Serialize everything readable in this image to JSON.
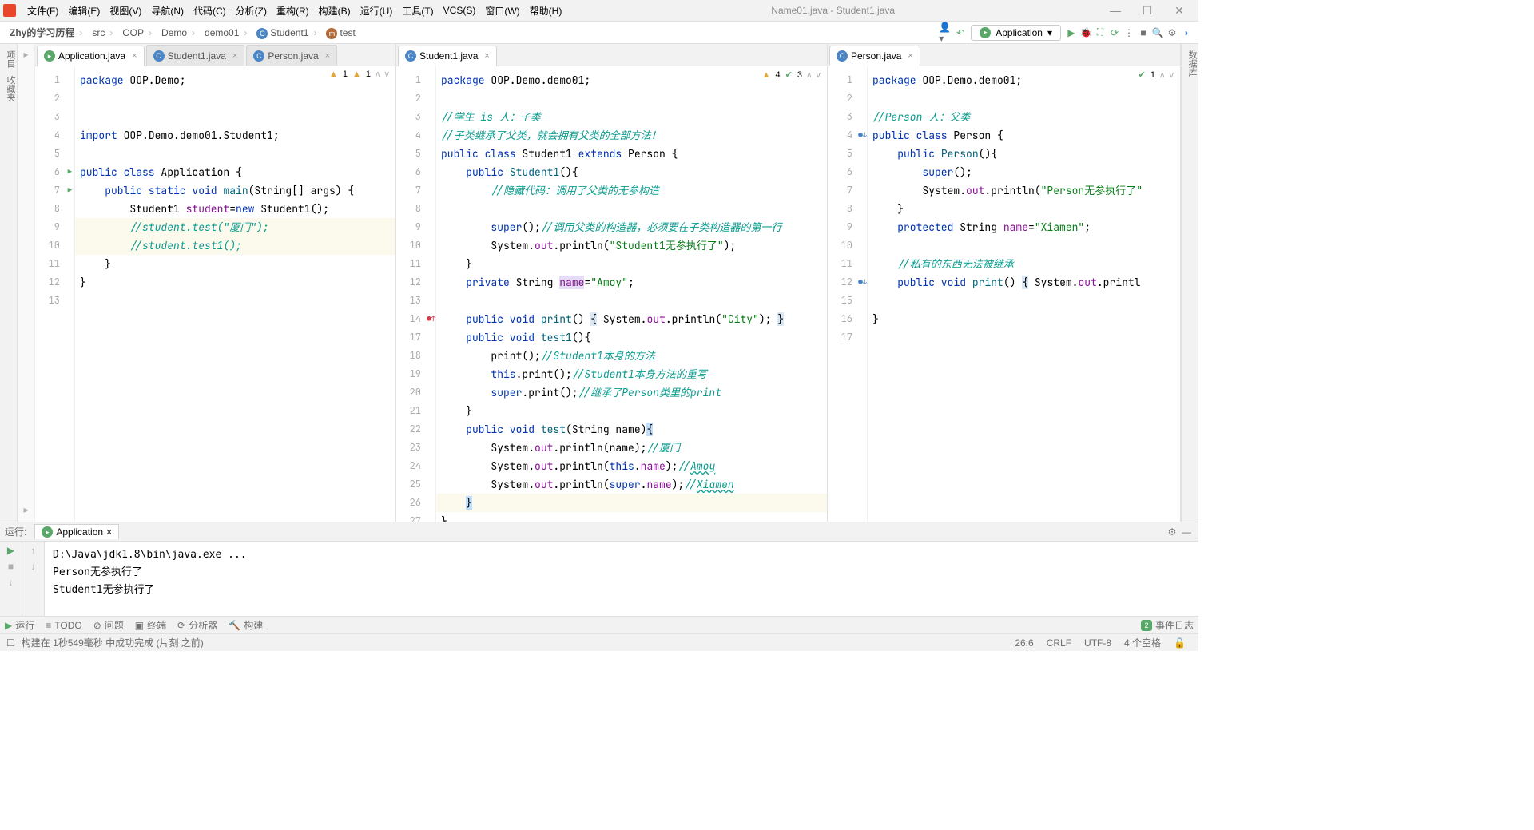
{
  "window": {
    "title": "Name01.java - Student1.java"
  },
  "menu": {
    "file": "文件(F)",
    "edit": "编辑(E)",
    "view": "视图(V)",
    "nav": "导航(N)",
    "code": "代码(C)",
    "analyze": "分析(Z)",
    "refactor": "重构(R)",
    "build": "构建(B)",
    "run": "运行(U)",
    "tools": "工具(T)",
    "vcs": "VCS(S)",
    "window": "窗口(W)",
    "help": "帮助(H)"
  },
  "breadcrumbs": [
    "Zhy的学习历程",
    "src",
    "OOP",
    "Demo",
    "demo01",
    "Student1",
    "test"
  ],
  "run_config": "Application",
  "panes": {
    "left": {
      "tabs": [
        {
          "label": "Application.java",
          "icon": "green",
          "active": true
        },
        {
          "label": "Student1.java",
          "icon": "blue",
          "active": false
        },
        {
          "label": "Person.java",
          "icon": "blue",
          "active": false
        }
      ],
      "insp": {
        "warn1": "1",
        "warn2": "1"
      },
      "lines": [
        {
          "n": "1",
          "html": "<span class='kw'>package</span> OOP.Demo;"
        },
        {
          "n": "2",
          "html": ""
        },
        {
          "n": "3",
          "html": ""
        },
        {
          "n": "4",
          "html": "<span class='kw'>import</span> OOP.Demo.demo01.Student1;"
        },
        {
          "n": "5",
          "html": ""
        },
        {
          "n": "6",
          "run": true,
          "html": "<span class='kw'>public class</span> Application {"
        },
        {
          "n": "7",
          "run": true,
          "html": "    <span class='kw'>public static void</span> <span class='mtd'>main</span>(String[] args) {"
        },
        {
          "n": "8",
          "html": "        Student1 <span class='fld'>student</span>=<span class='kw'>new</span> Student1();"
        },
        {
          "n": "9",
          "hl": true,
          "html": "        <span class='cmt-doc'>//student.test(\"厦门\");</span>"
        },
        {
          "n": "10",
          "hl": true,
          "html": "        <span class='cmt-doc'>//student.test1();</span>"
        },
        {
          "n": "11",
          "html": "    }"
        },
        {
          "n": "12",
          "html": "}"
        },
        {
          "n": "13",
          "html": ""
        }
      ]
    },
    "mid": {
      "tabs": [
        {
          "label": "Student1.java",
          "icon": "blue",
          "active": true
        }
      ],
      "insp": {
        "warn": "4",
        "ok": "3"
      },
      "lines": [
        {
          "n": "1",
          "html": "<span class='kw'>package</span> OOP.Demo.demo01;"
        },
        {
          "n": "2",
          "html": ""
        },
        {
          "n": "3",
          "html": "<span class='cmt-doc'>//学生 is 人：子类</span>"
        },
        {
          "n": "4",
          "html": "<span class='cmt-doc'>//子类继承了父类，就会拥有父类的全部方法！</span>"
        },
        {
          "n": "5",
          "html": "<span class='kw'>public class</span> Student1 <span class='kw'>extends</span> Person {"
        },
        {
          "n": "6",
          "html": "    <span class='kw'>public</span> <span class='mtd'>Student1</span>(){"
        },
        {
          "n": "7",
          "html": "        <span class='cmt-doc'>//隐藏代码：调用了父类的无参构造</span>"
        },
        {
          "n": "8",
          "html": ""
        },
        {
          "n": "9",
          "html": "        <span class='kw'>super</span>();<span class='cmt-doc'>//调用父类的构造器，必须要在子类构造器的第一行</span>"
        },
        {
          "n": "10",
          "html": "        System.<span class='fld'>out</span>.println(<span class='str'>\"Student1无参执行了\"</span>);"
        },
        {
          "n": "11",
          "html": "    }"
        },
        {
          "n": "12",
          "html": "    <span class='kw'>private</span> String <span class='hl-name fld'>name</span>=<span class='str'>\"Amoy\"</span>;"
        },
        {
          "n": "13",
          "html": ""
        },
        {
          "n": "14",
          "mark": "u",
          "html": "    <span class='kw'>public void</span> <span class='mtd'>print</span>() <span class='hl-brace'>{</span> System.<span class='fld'>out</span>.println(<span class='str'>\"City\"</span>); <span class='hl-brace'>}</span>"
        },
        {
          "n": "17",
          "html": "    <span class='kw'>public void</span> <span class='mtd'>test1</span>(){"
        },
        {
          "n": "18",
          "html": "        print();<span class='cmt-doc'>//Student1本身的方法</span>"
        },
        {
          "n": "19",
          "html": "        <span class='kw'>this</span>.print();<span class='cmt-doc'>//Student1本身方法的重写</span>"
        },
        {
          "n": "20",
          "html": "        <span class='kw'>super</span>.print();<span class='cmt-doc'>//继承了Person类里的print</span>"
        },
        {
          "n": "21",
          "html": "    }"
        },
        {
          "n": "22",
          "html": "    <span class='kw'>public void</span> <span class='mtd'>test</span>(String name)<span class='bg-cursor'>{</span>"
        },
        {
          "n": "23",
          "html": "        System.<span class='fld'>out</span>.println(name);<span class='cmt-doc'>//厦门</span>"
        },
        {
          "n": "24",
          "html": "        System.<span class='fld'>out</span>.println(<span class='kw'>this</span>.<span class='fld'>name</span>);<span class='cmt-doc'>//<span class='underline-wavy'>Amoy</span></span>"
        },
        {
          "n": "25",
          "html": "        System.<span class='fld'>out</span>.println(<span class='kw'>super</span>.<span class='fld'>name</span>);<span class='cmt-doc'>//<span class='underline-wavy'>Xiamen</span></span>"
        },
        {
          "n": "26",
          "hl": true,
          "html": "    <span class='bg-cursor'>}</span>"
        },
        {
          "n": "27",
          "html": "}"
        }
      ]
    },
    "right": {
      "tabs": [
        {
          "label": "Person.java",
          "icon": "blue",
          "active": true
        }
      ],
      "insp": {
        "ok": "1"
      },
      "lines": [
        {
          "n": "1",
          "html": "<span class='kw'>package</span> OOP.Demo.demo01;"
        },
        {
          "n": "2",
          "html": ""
        },
        {
          "n": "3",
          "html": "<span class='cmt-doc'>//Person 人：父类</span>"
        },
        {
          "n": "4",
          "mark": "o",
          "html": "<span class='kw'>public class</span> Person {"
        },
        {
          "n": "5",
          "html": "    <span class='kw'>public</span> <span class='mtd'>Person</span>(){"
        },
        {
          "n": "6",
          "html": "        <span class='kw'>super</span>();"
        },
        {
          "n": "7",
          "html": "        System.<span class='fld'>out</span>.println(<span class='str'>\"Person无参执行了\"</span>"
        },
        {
          "n": "8",
          "html": "    }"
        },
        {
          "n": "9",
          "html": "    <span class='kw'>protected</span> String <span class='fld'>name</span>=<span class='str'>\"Xiamen\"</span>;"
        },
        {
          "n": "10",
          "html": ""
        },
        {
          "n": "11",
          "html": "    <span class='cmt-doc'>//私有的东西无法被继承</span>"
        },
        {
          "n": "12",
          "mark": "o",
          "html": "    <span class='kw'>public void</span> <span class='mtd'>print</span>() <span class='hl-brace'>{</span> System.<span class='fld'>out</span>.printl"
        },
        {
          "n": "15",
          "html": ""
        },
        {
          "n": "16",
          "html": "}"
        },
        {
          "n": "17",
          "html": ""
        }
      ]
    }
  },
  "run_panel": {
    "label": "运行:",
    "app": "Application",
    "console": [
      "D:\\Java\\jdk1.8\\bin\\java.exe ...",
      "Person无参执行了",
      "Student1无参执行了"
    ]
  },
  "bottom_bar": {
    "run": "运行",
    "todo": "TODO",
    "problems": "问题",
    "terminal": "终端",
    "analyzer": "分析器",
    "build": "构建",
    "events": "事件日志"
  },
  "status": {
    "msg": "构建在 1秒549毫秒 中成功完成 (片刻 之前)",
    "pos": "26:6",
    "eol": "CRLF",
    "enc": "UTF-8",
    "indent": "4 个空格"
  }
}
